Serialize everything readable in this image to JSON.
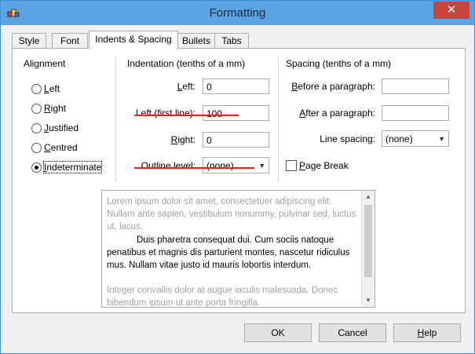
{
  "window": {
    "title": "Formatting",
    "close_glyph": "✕"
  },
  "tabs": [
    {
      "label": "Style",
      "active": false
    },
    {
      "label": "Font",
      "active": false
    },
    {
      "label": "Indents & Spacing",
      "active": true
    },
    {
      "label": "Bullets",
      "active": false
    },
    {
      "label": "Tabs",
      "active": false
    }
  ],
  "alignment": {
    "heading": "Alignment",
    "options": [
      {
        "label": "Left",
        "checked": false
      },
      {
        "label": "Right",
        "checked": false
      },
      {
        "label": "Justified",
        "checked": false
      },
      {
        "label": "Centred",
        "checked": false
      },
      {
        "label": "Indeterminate",
        "checked": true
      }
    ]
  },
  "indentation": {
    "heading": "Indentation (tenths of a mm)",
    "left_label": "Left:",
    "left_value": "0",
    "first_line_label": "Left (first line):",
    "first_line_value": "100",
    "right_label": "Right:",
    "right_value": "0",
    "outline_label": "Outline level:",
    "outline_value": "(none)"
  },
  "spacing": {
    "heading": "Spacing (tenths of a mm)",
    "before_label": "Before a paragraph:",
    "before_value": "",
    "after_label": "After a paragraph:",
    "after_value": "",
    "line_spacing_label": "Line spacing:",
    "line_spacing_value": "(none)"
  },
  "page_break": {
    "label": "Page Break",
    "checked": false
  },
  "preview": {
    "before_text": "Lorem ipsum dolor sit amet, consectetuer adipiscing elit. Nullam ante sapien, vestibulum nonummy, pulvinar sed, luctus ut, lacus.",
    "main_text": "Duis pharetra consequat dui. Cum sociis natoque penatibus et magnis dis parturient montes, nascetur ridiculus mus. Nullam vitae justo id mauris lobortis interdum.",
    "after_text": "Integer convallis dolor at augue iaculis malesuada. Donec bibendum ipsum ut ante porta fringilla."
  },
  "buttons": {
    "ok": "OK",
    "cancel": "Cancel",
    "help": "Help"
  },
  "colors": {
    "titlebar": "#5aa4e3",
    "close": "#c7453a",
    "annotation": "#e2231a"
  }
}
